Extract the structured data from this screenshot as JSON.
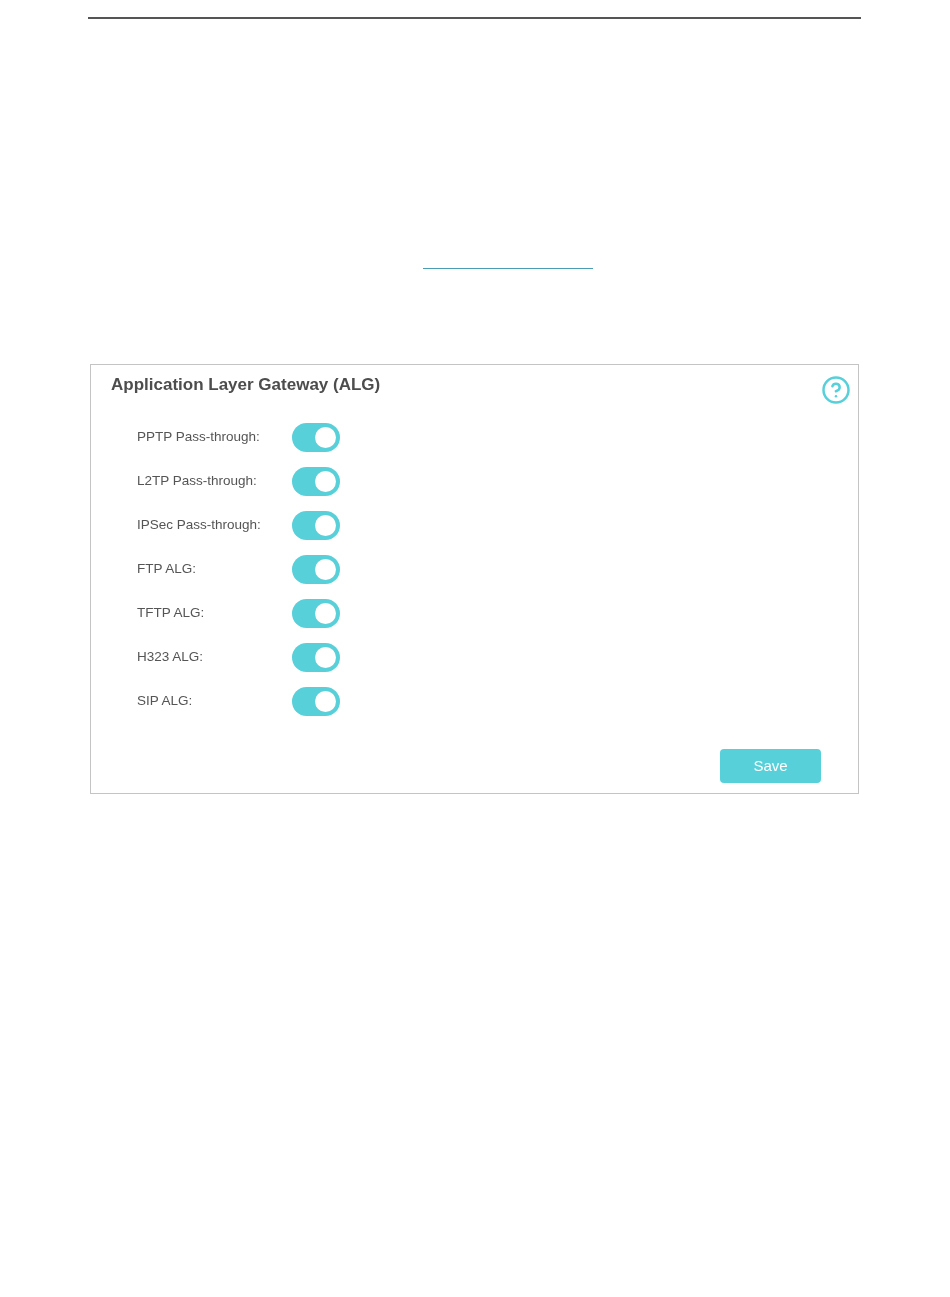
{
  "panel": {
    "title": "Application Layer Gateway (ALG)",
    "settings": [
      {
        "label": "PPTP Pass-through:",
        "on": true
      },
      {
        "label": "L2TP Pass-through:",
        "on": true
      },
      {
        "label": "IPSec Pass-through:",
        "on": true
      },
      {
        "label": "FTP ALG:",
        "on": true
      },
      {
        "label": "TFTP ALG:",
        "on": true
      },
      {
        "label": "H323 ALG:",
        "on": true
      },
      {
        "label": "SIP ALG:",
        "on": true
      }
    ],
    "save_button": "Save"
  }
}
